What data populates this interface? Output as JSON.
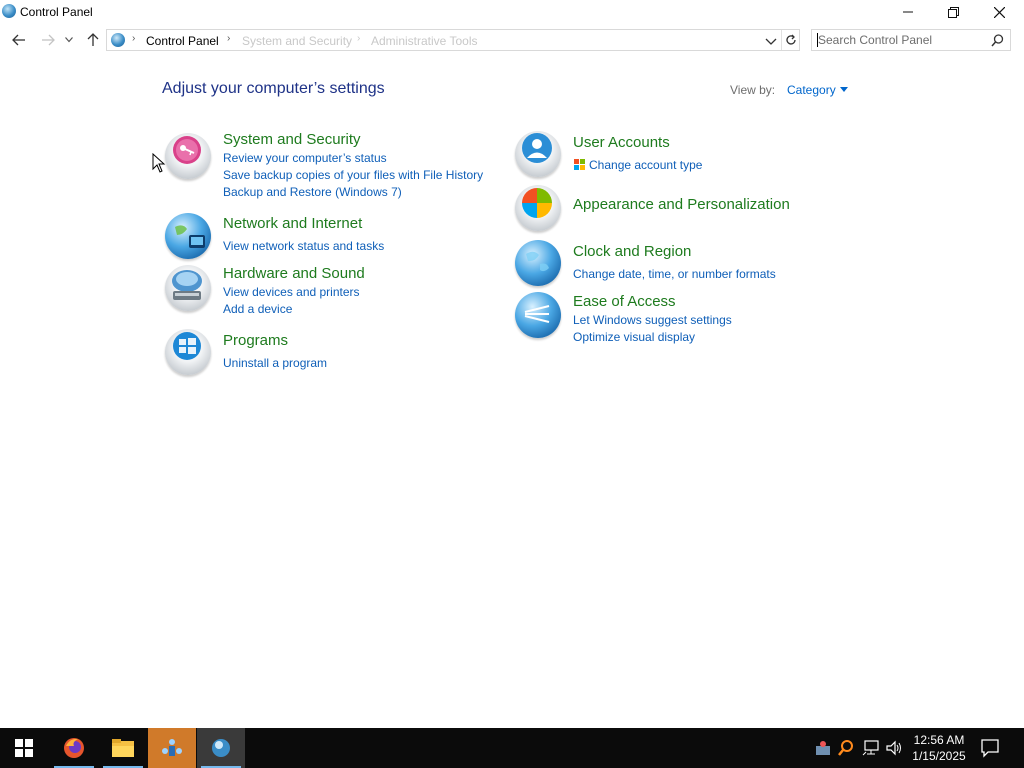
{
  "window": {
    "title": "Control Panel"
  },
  "address": {
    "crumbs": [
      "Control Panel",
      "System and Security",
      "Administrative Tools"
    ]
  },
  "search": {
    "placeholder": "Search Control Panel"
  },
  "content": {
    "heading": "Adjust your computer’s settings",
    "view_by_label": "View by:",
    "view_by_value": "Category"
  },
  "categories": {
    "system_security": {
      "title": "System and Security",
      "links": [
        "Review your computer’s status",
        "Save backup copies of your files with File History",
        "Backup and Restore (Windows 7)"
      ]
    },
    "network": {
      "title": "Network and Internet",
      "links": [
        "View network status and tasks"
      ]
    },
    "hardware": {
      "title": "Hardware and Sound",
      "links": [
        "View devices and printers",
        "Add a device"
      ]
    },
    "programs": {
      "title": "Programs",
      "links": [
        "Uninstall a program"
      ]
    },
    "user_accounts": {
      "title": "User Accounts",
      "links": [
        "Change account type"
      ]
    },
    "appearance": {
      "title": "Appearance and Personalization",
      "links": []
    },
    "clock": {
      "title": "Clock and Region",
      "links": [
        "Change date, time, or number formats"
      ]
    },
    "ease": {
      "title": "Ease of Access",
      "links": [
        "Let Windows suggest settings",
        "Optimize visual display"
      ]
    }
  },
  "taskbar": {
    "time": "12:56 AM",
    "date": "1/15/2025",
    "apps": [
      "start-icon",
      "firefox-icon",
      "file-explorer-icon",
      "network-tool-icon",
      "control-panel-icon"
    ]
  },
  "colors": {
    "heading": "#1e3287",
    "category_title": "#1e7b1e",
    "link": "#0f5fb8",
    "taskbar": "#0b0b0b"
  }
}
